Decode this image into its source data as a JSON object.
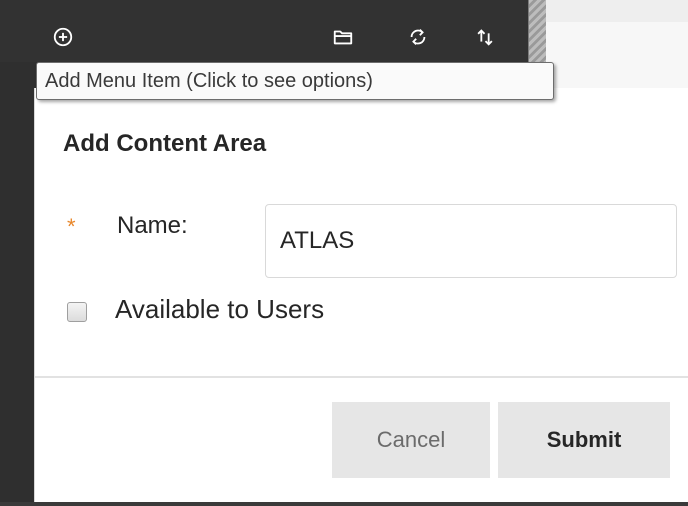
{
  "toolbar": {
    "icons": [
      "add-circle-icon",
      "folder-icon",
      "refresh-icon",
      "sort-icon"
    ]
  },
  "tooltip": {
    "text": "Add Menu Item (Click to see options)"
  },
  "dialog": {
    "title": "Add Content Area",
    "required_marker": "*",
    "name_label": "Name:",
    "name_value": "ATLAS",
    "available_label": "Available to Users",
    "available_checked": false,
    "cancel_label": "Cancel",
    "submit_label": "Submit"
  },
  "colors": {
    "nav_background": "#2f2f2f",
    "required_star": "#e8872b",
    "button_background": "#e6e6e6"
  }
}
